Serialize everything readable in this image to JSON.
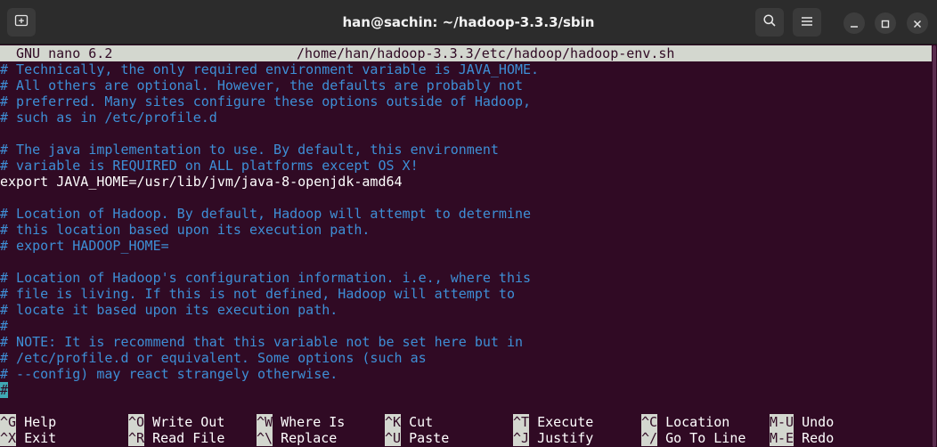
{
  "window": {
    "title": "han@sachin: ~/hadoop-3.3.3/sbin"
  },
  "nano": {
    "version": "GNU nano 6.2",
    "filepath": "/home/han/hadoop-3.3.3/etc/hadoop/hadoop-env.sh"
  },
  "lines": [
    {
      "type": "comment",
      "text": "# Technically, the only required environment variable is JAVA_HOME."
    },
    {
      "type": "comment",
      "text": "# All others are optional. However, the defaults are probably not"
    },
    {
      "type": "comment",
      "text": "# preferred. Many sites configure these options outside of Hadoop,"
    },
    {
      "type": "comment",
      "text": "# such as in /etc/profile.d"
    },
    {
      "type": "blank",
      "text": ""
    },
    {
      "type": "comment",
      "text": "# The java implementation to use. By default, this environment"
    },
    {
      "type": "comment",
      "text": "# variable is REQUIRED on ALL platforms except OS X!"
    },
    {
      "type": "code",
      "text": "export JAVA_HOME=/usr/lib/jvm/java-8-openjdk-amd64"
    },
    {
      "type": "blank",
      "text": ""
    },
    {
      "type": "comment",
      "text": "# Location of Hadoop. By default, Hadoop will attempt to determine"
    },
    {
      "type": "comment",
      "text": "# this location based upon its execution path."
    },
    {
      "type": "comment",
      "text": "# export HADOOP_HOME="
    },
    {
      "type": "blank",
      "text": ""
    },
    {
      "type": "comment",
      "text": "# Location of Hadoop's configuration information. i.e., where this"
    },
    {
      "type": "comment",
      "text": "# file is living. If this is not defined, Hadoop will attempt to"
    },
    {
      "type": "comment",
      "text": "# locate it based upon its execution path."
    },
    {
      "type": "comment",
      "text": "#"
    },
    {
      "type": "comment",
      "text": "# NOTE: It is recommend that this variable not be set here but in"
    },
    {
      "type": "comment",
      "text": "# /etc/profile.d or equivalent. Some options (such as"
    },
    {
      "type": "comment",
      "text": "# --config) may react strangely otherwise."
    },
    {
      "type": "cursor",
      "text": "#"
    }
  ],
  "shortcuts": [
    {
      "key": "^G",
      "label": "Help"
    },
    {
      "key": "^X",
      "label": "Exit"
    },
    {
      "key": "^O",
      "label": "Write Out"
    },
    {
      "key": "^R",
      "label": "Read File"
    },
    {
      "key": "^W",
      "label": "Where Is"
    },
    {
      "key": "^\\",
      "label": "Replace"
    },
    {
      "key": "^K",
      "label": "Cut"
    },
    {
      "key": "^U",
      "label": "Paste"
    },
    {
      "key": "^T",
      "label": "Execute"
    },
    {
      "key": "^J",
      "label": "Justify"
    },
    {
      "key": "^C",
      "label": "Location"
    },
    {
      "key": "^/",
      "label": "Go To Line"
    },
    {
      "key": "M-U",
      "label": "Undo"
    },
    {
      "key": "M-E",
      "label": "Redo"
    }
  ],
  "icons": {
    "new_tab": "new-tab-icon",
    "search": "search-icon",
    "menu": "hamburger-menu-icon",
    "minimize": "minimize-icon",
    "maximize": "maximize-icon",
    "close": "close-icon"
  },
  "colors": {
    "terminal_bg": "#300a24",
    "comment": "#3e8fd6",
    "header_bg": "#d3d7cf",
    "cursor": "#3fa9b5"
  }
}
